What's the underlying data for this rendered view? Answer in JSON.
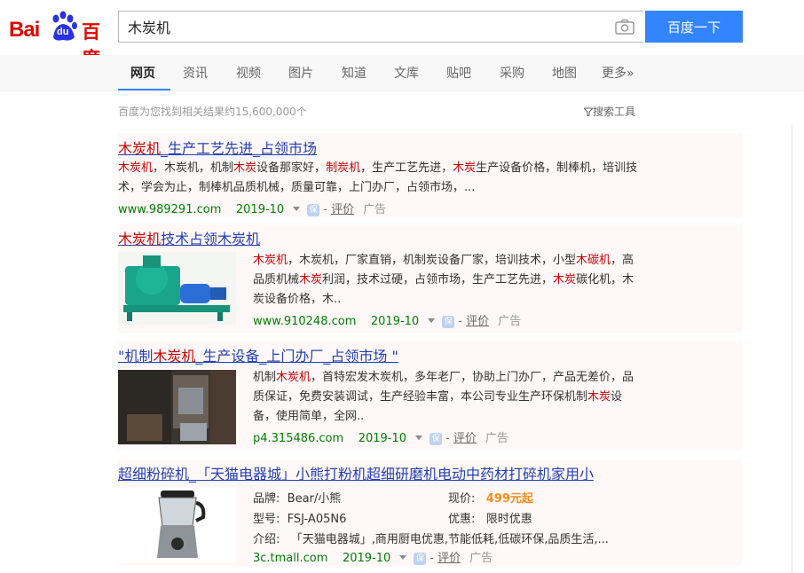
{
  "header": {
    "logo_bai": "Bai",
    "logo_du": "du",
    "logo_cn": "百度",
    "query": "木炭机",
    "search_button": "百度一下"
  },
  "nav": {
    "tabs": [
      {
        "label": "网页",
        "active": true
      },
      {
        "label": "资讯"
      },
      {
        "label": "视频"
      },
      {
        "label": "图片"
      },
      {
        "label": "知道"
      },
      {
        "label": "文库"
      },
      {
        "label": "贴吧"
      },
      {
        "label": "采购"
      },
      {
        "label": "地图"
      },
      {
        "label": "更多»"
      }
    ]
  },
  "stats": "百度为您找到相关结果约15,600,000个",
  "tools": "搜索工具",
  "results": [
    {
      "title_parts": [
        [
          "木炭机",
          true
        ],
        [
          "_生产工艺先进_占领市场",
          false
        ]
      ],
      "desc_parts": [
        [
          "木炭机",
          true
        ],
        [
          "，木炭机，机制",
          false
        ],
        [
          "木炭",
          true
        ],
        [
          "设备那家好，",
          false
        ],
        [
          "制炭机",
          true
        ],
        [
          "，生产工艺先进，",
          false
        ],
        [
          "木炭",
          true
        ],
        [
          "生产设备价格，制棒机，培训技术，学会为止，制棒机品质机械，质量可靠，上门办厂，占领市场，...",
          false
        ]
      ],
      "url": "www.989291.com",
      "date": "2019-10",
      "bao": "保",
      "eval": "评价",
      "ad": "广告"
    },
    {
      "title_parts": [
        [
          "木炭机",
          true
        ],
        [
          "技术占领木炭机",
          false
        ]
      ],
      "desc_parts": [
        [
          "木炭机",
          true
        ],
        [
          "，木炭机，厂家直销，机制炭设备厂家，培训技术，小型",
          false
        ],
        [
          "木碳机",
          true
        ],
        [
          "，高品质机械",
          false
        ],
        [
          "木炭",
          true
        ],
        [
          "利润，技术过硬，占领市场，生产工艺先进，",
          false
        ],
        [
          "木炭",
          true
        ],
        [
          "碳化机，木炭设备价格，木..",
          false
        ]
      ],
      "url": "www.910248.com",
      "date": "2019-10",
      "bao": "保",
      "eval": "评价",
      "ad": "广告"
    },
    {
      "title_parts": [
        [
          "\"机制",
          false
        ],
        [
          "木炭机",
          true
        ],
        [
          "_生产设备_上门办厂_占领市场 \"",
          false
        ]
      ],
      "desc_parts": [
        [
          "机制",
          false
        ],
        [
          "木炭机",
          true
        ],
        [
          "，首特宏发木炭机，多年老厂，协助上门办厂，产品无差价，品质保证，免费安装调试，生产经验丰富，本公司专业生产环保机制",
          false
        ],
        [
          "木炭",
          true
        ],
        [
          "设备，使用简单，全网..",
          false
        ]
      ],
      "url": "p4.315486.com",
      "date": "2019-10",
      "bao": "保",
      "eval": "评价",
      "ad": "广告"
    },
    {
      "title_parts": [
        [
          "超细粉碎机_「天猫电器城」小熊打粉机超细研磨机电动中药材打碎机家用小",
          false
        ]
      ],
      "brand_label": "品牌:",
      "brand": "Bear/小熊",
      "price_label": "现价:",
      "price": "499元起",
      "model_label": "型号:",
      "model": "FSJ-A05N6",
      "promo_label": "优惠:",
      "promo": "限时优惠",
      "intro_label": "介绍:",
      "intro": "「天猫电器城」,商用厨电优惠,节能低耗,低碳环保,品质生活,...",
      "url": "3c.tmall.com",
      "date": "2019-10",
      "bao": "保",
      "eval": "评价",
      "ad": "广告"
    }
  ]
}
